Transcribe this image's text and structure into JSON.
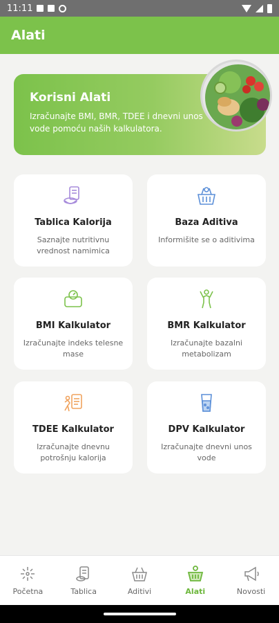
{
  "status_bar": {
    "time": "11:11"
  },
  "app_bar": {
    "title": "Alati"
  },
  "hero": {
    "title": "Korisni Alati",
    "subtitle": "Izračunajte BMI, BMR, TDEE i dnevni unos vode pomoću naših kalkulatora."
  },
  "cards": [
    {
      "title": "Tablica Kalorija",
      "desc": "Saznajte nutritivnu vrednost namimica",
      "icon": "food-scale-icon",
      "color": "#a78bdb"
    },
    {
      "title": "Baza Aditiva",
      "desc": "Informišite se o aditivima",
      "icon": "basket-icon",
      "color": "#5b8fd8"
    },
    {
      "title": "BMI Kalkulator",
      "desc": "Izračunajte indeks telesne mase",
      "icon": "bathroom-scale-icon",
      "color": "#7cc24b"
    },
    {
      "title": "BMR Kalkulator",
      "desc": "Izračunajte bazalni metabolizam",
      "icon": "body-figure-icon",
      "color": "#7cc24b"
    },
    {
      "title": "TDEE Kalkulator",
      "desc": "Izračunajte dnevnu potrošnju kalorija",
      "icon": "runner-chart-icon",
      "color": "#f0a35e"
    },
    {
      "title": "DPV Kalkulator",
      "desc": "Izračunajte dnevni unos vode",
      "icon": "water-glass-icon",
      "color": "#5b8fd8"
    }
  ],
  "bottom_nav": [
    {
      "label": "Početna",
      "icon": "home-sparkle-icon",
      "active": false
    },
    {
      "label": "Tablica",
      "icon": "tablet-list-icon",
      "active": false
    },
    {
      "label": "Aditivi",
      "icon": "basket-icon",
      "active": false
    },
    {
      "label": "Alati",
      "icon": "tools-basket-icon",
      "active": true
    },
    {
      "label": "Novosti",
      "icon": "megaphone-icon",
      "active": false
    }
  ],
  "colors": {
    "primary": "#7cc24b",
    "active_nav": "#6db73c",
    "background": "#f3f3f1"
  }
}
